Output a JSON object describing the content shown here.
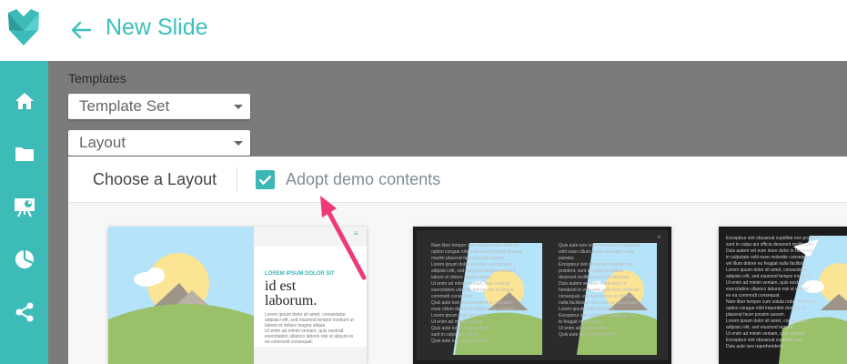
{
  "header": {
    "title": "New Slide"
  },
  "sidebar": {
    "items": [
      {
        "name": "home",
        "icon": "home-icon"
      },
      {
        "name": "folder",
        "icon": "folder-icon"
      },
      {
        "name": "presentation",
        "icon": "presentation-icon"
      },
      {
        "name": "chart",
        "icon": "pie-chart-icon"
      },
      {
        "name": "share",
        "icon": "share-icon"
      }
    ]
  },
  "templates": {
    "label": "Templates",
    "template_set": {
      "value": "Template Set"
    },
    "layout": {
      "value": "Layout"
    }
  },
  "layout_panel": {
    "title": "Choose a Layout",
    "adopt_label": "Adopt demo contents",
    "adopt_checked": true,
    "thumbs": [
      {
        "kicker": "LOREM IPSUM DOLOR SIT",
        "headline_line1": "id est",
        "headline_line2": "laborum.",
        "body": [
          "Lorem ipsum dolor sit amet, consectetur",
          "adipisici elit, sed eiusmod tempor incidunt ut",
          "labore et dolore magna aliqua.",
          "Ut enim ad minim veniam, quis nostrud",
          "exercitation ullamco laboris nisi ut aliquid ex",
          "ea commodi consequat."
        ]
      },
      {
        "col1": [
          "Nam liber tempor cum soluta nobis eleifend",
          "option congue nihil imperdiet doming id quod",
          "mazim placerat facer possim assum.",
          "Lorem ipsum dolor sit amet, consectetur",
          "adipisici elit, sed eiusmod tempor incidunt",
          "labore et dolore magna aliqua.",
          "Ut enim ad minim veniam, quis nostrud",
          "exercitation ullamco laboris nisi ut aliquid",
          "commodi consequat.",
          "Quis aute iure reprehenderit in voluptate",
          "esse cillum dolore eu fugiat nulla pariatur.",
          "Lorem ipsum dolor sit amet.",
          "Ut enim ad minim veniam.",
          "Quis aute iure reprehenderit.",
          "sunt in culpa qui officia.",
          "Quis aute iure reprehenderit."
        ],
        "col2": [
          "Quis aute iure reprehenderit in voluptate",
          "velit esse cillum dolore eu fugiat nulla",
          "pariatur.",
          "Excepteur sint obcaecat cupiditat non",
          "proident, sunt in culpa qui officia",
          "deserunt mollit anim id est laborum.",
          "Duis autem vel eum iriure dolor in",
          "hendrerit in vulputate velit esse molestie",
          "consequat, vel illum dolore eu feugiat",
          "nulla facilisis at vero eros et accumsan.",
          "Lorem ipsum dolor sit amet.",
          "Excepteur sint occaecat cupidatat non",
          "te feugait nulla facilisi.",
          "Ut enim ad minim veniam.",
          "Quis aute iure reprehenderit."
        ]
      },
      {
        "lines": [
          "Excepteur sint obcaecat cupiditat non proident",
          "sunt in culpa qui officia deserunt mollit anim",
          "Duis autem vel eum iriure dolor in hendrerit",
          "in vulputate velit esse molestie consequat,",
          "vel illum dolore eu feugiat nulla facilisis.",
          "Lorem ipsum dolor sit amet, consectetur",
          "adipisici elit, sed eiusmod tempor incidunt",
          "Ut enim ad minim veniam, quis nostrud",
          "exercitation ullamco laboris nisi ut aliquid",
          "ex ea commodi consequat.",
          "Nam liber tempor cum soluta nobis eleifend",
          "option congue nihil imperdiet doming id",
          "placerat facer possim assum.",
          "Lorem ipsum dolor sit amet, consectetur",
          "adipisici elit, sed eiusmod tempor.",
          "Ut enim ad minim veniam, quis nostrud",
          "Excepteur sint obcaecat cupiditat non.",
          "Duis aute iure reprehenderit."
        ]
      }
    ]
  },
  "colors": {
    "accent": "#3cc0bd",
    "sidebar": "#3dbbb9",
    "overlay": "#7b7b7b",
    "arrow": "#ee3a76",
    "checkbox": "#3cb7b6"
  }
}
